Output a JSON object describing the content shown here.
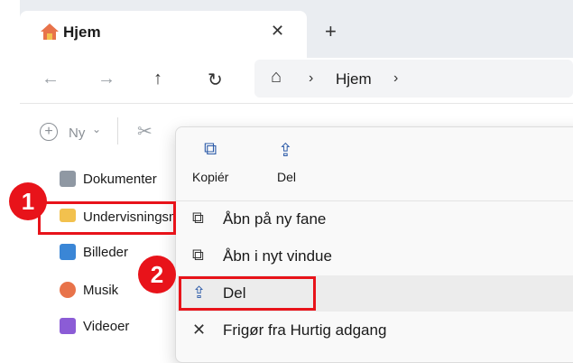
{
  "tab": {
    "title": "Hjem",
    "close_glyph": "✕",
    "new_glyph": "+"
  },
  "nav": {
    "back_glyph": "←",
    "forward_glyph": "→",
    "up_glyph": "↑",
    "refresh_glyph": "↻",
    "home_glyph": "⌂",
    "chevron": "›",
    "crumb": "Hjem"
  },
  "toolbar": {
    "new_label": "Ny",
    "new_caret": "⌄",
    "cut_glyph": "✂"
  },
  "sidebar": {
    "items": [
      {
        "label": "Dokumenter",
        "icon": "document-icon",
        "color": "#8f98a3"
      },
      {
        "label": "Undervisningsm",
        "icon": "folder-icon",
        "color": "#f2c14e"
      },
      {
        "label": "Billeder",
        "icon": "pictures-icon",
        "color": "#3a86d6"
      },
      {
        "label": "Musik",
        "icon": "music-icon",
        "color": "#e8734a"
      },
      {
        "label": "Videoer",
        "icon": "videos-icon",
        "color": "#8b5cd6"
      }
    ]
  },
  "context_menu": {
    "top_actions": [
      {
        "label": "Kopiér",
        "icon": "copy-icon",
        "glyph": "⧉"
      },
      {
        "label": "Del",
        "icon": "share-icon",
        "glyph": "⇪"
      }
    ],
    "items": [
      {
        "label": "Åbn på ny fane",
        "icon": "open-new-tab-icon",
        "glyph": "⧉"
      },
      {
        "label": "Åbn i nyt vindue",
        "icon": "open-new-window-icon",
        "glyph": "⧉"
      },
      {
        "label": "Del",
        "icon": "share-icon",
        "glyph": "⇪"
      },
      {
        "label": "Frigør fra Hurtig adgang",
        "icon": "unpin-icon",
        "glyph": "✕"
      }
    ]
  },
  "annotations": {
    "step1": "1",
    "step2": "2"
  },
  "colors": {
    "highlight": "#e8131a",
    "accent": "#2b5aa8"
  }
}
